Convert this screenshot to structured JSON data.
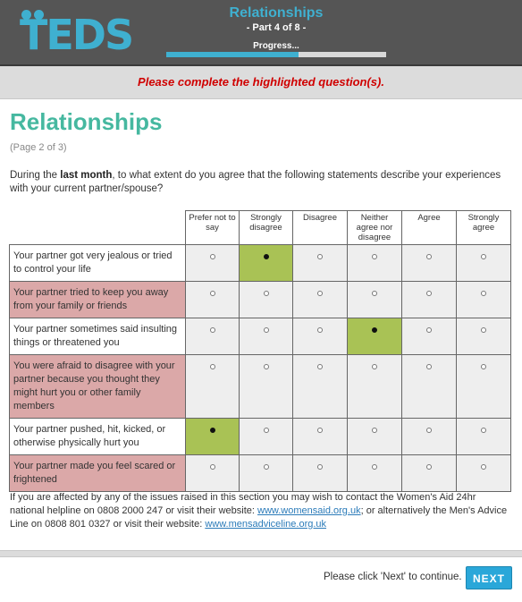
{
  "header": {
    "logo_text": "TEDS",
    "section_title": "Relationships",
    "part_label": "- Part 4 of 8 -",
    "progress_label": "Progress...",
    "progress_fraction": 0.6
  },
  "warning": "Please complete the highlighted question(s).",
  "page": {
    "title": "Relationships",
    "subtitle": "(Page 2 of 3)",
    "instruction_pre": "During the ",
    "instruction_bold": "last month",
    "instruction_post": ", to what extent do you agree that the following statements describe your experiences with your current partner/spouse?"
  },
  "grid": {
    "options": [
      "Prefer not to say",
      "Strongly disagree",
      "Disagree",
      "Neither agree nor disagree",
      "Agree",
      "Strongly agree"
    ],
    "rows": [
      {
        "text": "Your partner got very jealous or tried to control your life",
        "selected": 1,
        "error": false
      },
      {
        "text": "Your partner tried to keep you away from your family or friends",
        "selected": -1,
        "error": true
      },
      {
        "text": "Your partner sometimes said insulting things or threatened you",
        "selected": 3,
        "error": false
      },
      {
        "text": "You were afraid to disagree with your partner because you thought they might hurt you or other family members",
        "selected": -1,
        "error": true
      },
      {
        "text": "Your partner pushed, hit, kicked, or otherwise physically hurt you",
        "selected": 0,
        "error": false
      },
      {
        "text": "Your partner made you feel scared or frightened",
        "selected": -1,
        "error": true
      }
    ]
  },
  "footer_note": {
    "text1": "If you are affected by any of the issues raised in this section you may wish to contact the Women's Aid 24hr national helpline on 0808 2000 247 or visit their website: ",
    "link1": "www.womensaid.org.uk",
    "text2": "; or alternatively the Men's Advice Line on 0808 801 0327 or visit their website: ",
    "link2": "www.mensadviceline.org.uk"
  },
  "bottom": {
    "continue_text": "Please click 'Next' to continue.",
    "next_label": "NEXT"
  },
  "colors": {
    "accent": "#3fb0d0",
    "title_green": "#46b8a0",
    "error_row": "#dba8a8",
    "selected_cell": "#a9c255",
    "warning_red": "#d00000"
  }
}
